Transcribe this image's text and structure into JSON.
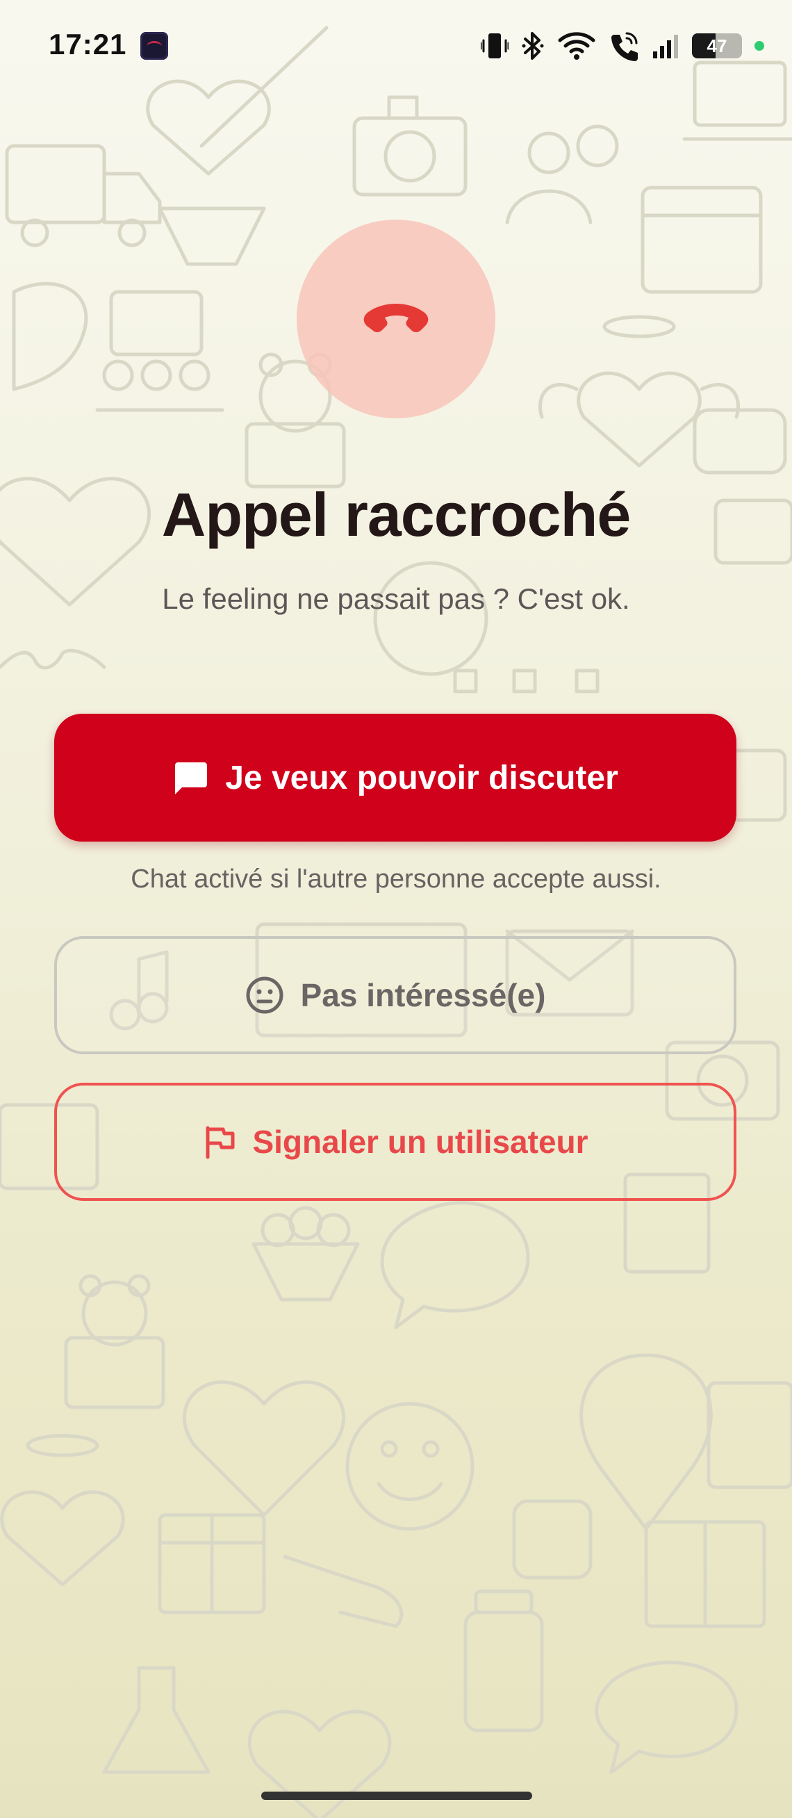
{
  "status_bar": {
    "time": "17:21",
    "battery_level": "47",
    "icons": [
      "app-icon",
      "vibrate-icon",
      "bluetooth-icon",
      "wifi-icon",
      "wifi-call-icon",
      "signal-icon",
      "battery-icon",
      "notification-dot-icon"
    ]
  },
  "hangup": {
    "icon": "phone-hangup-icon",
    "color": "#e53935"
  },
  "title": "Appel raccroché",
  "subtitle": "Le feeling ne passait pas ? C'est ok.",
  "chat_button": {
    "label": "Je veux pouvoir discuter",
    "icon": "chat-bubble-icon",
    "color": "#d0021b"
  },
  "chat_note": "Chat activé si l'autre personne accepte aussi.",
  "not_interested_button": {
    "label": "Pas intéressé(e)",
    "icon": "neutral-face-icon"
  },
  "report_button": {
    "label": "Signaler un utilisateur",
    "icon": "flag-icon",
    "color": "#e8484a"
  }
}
